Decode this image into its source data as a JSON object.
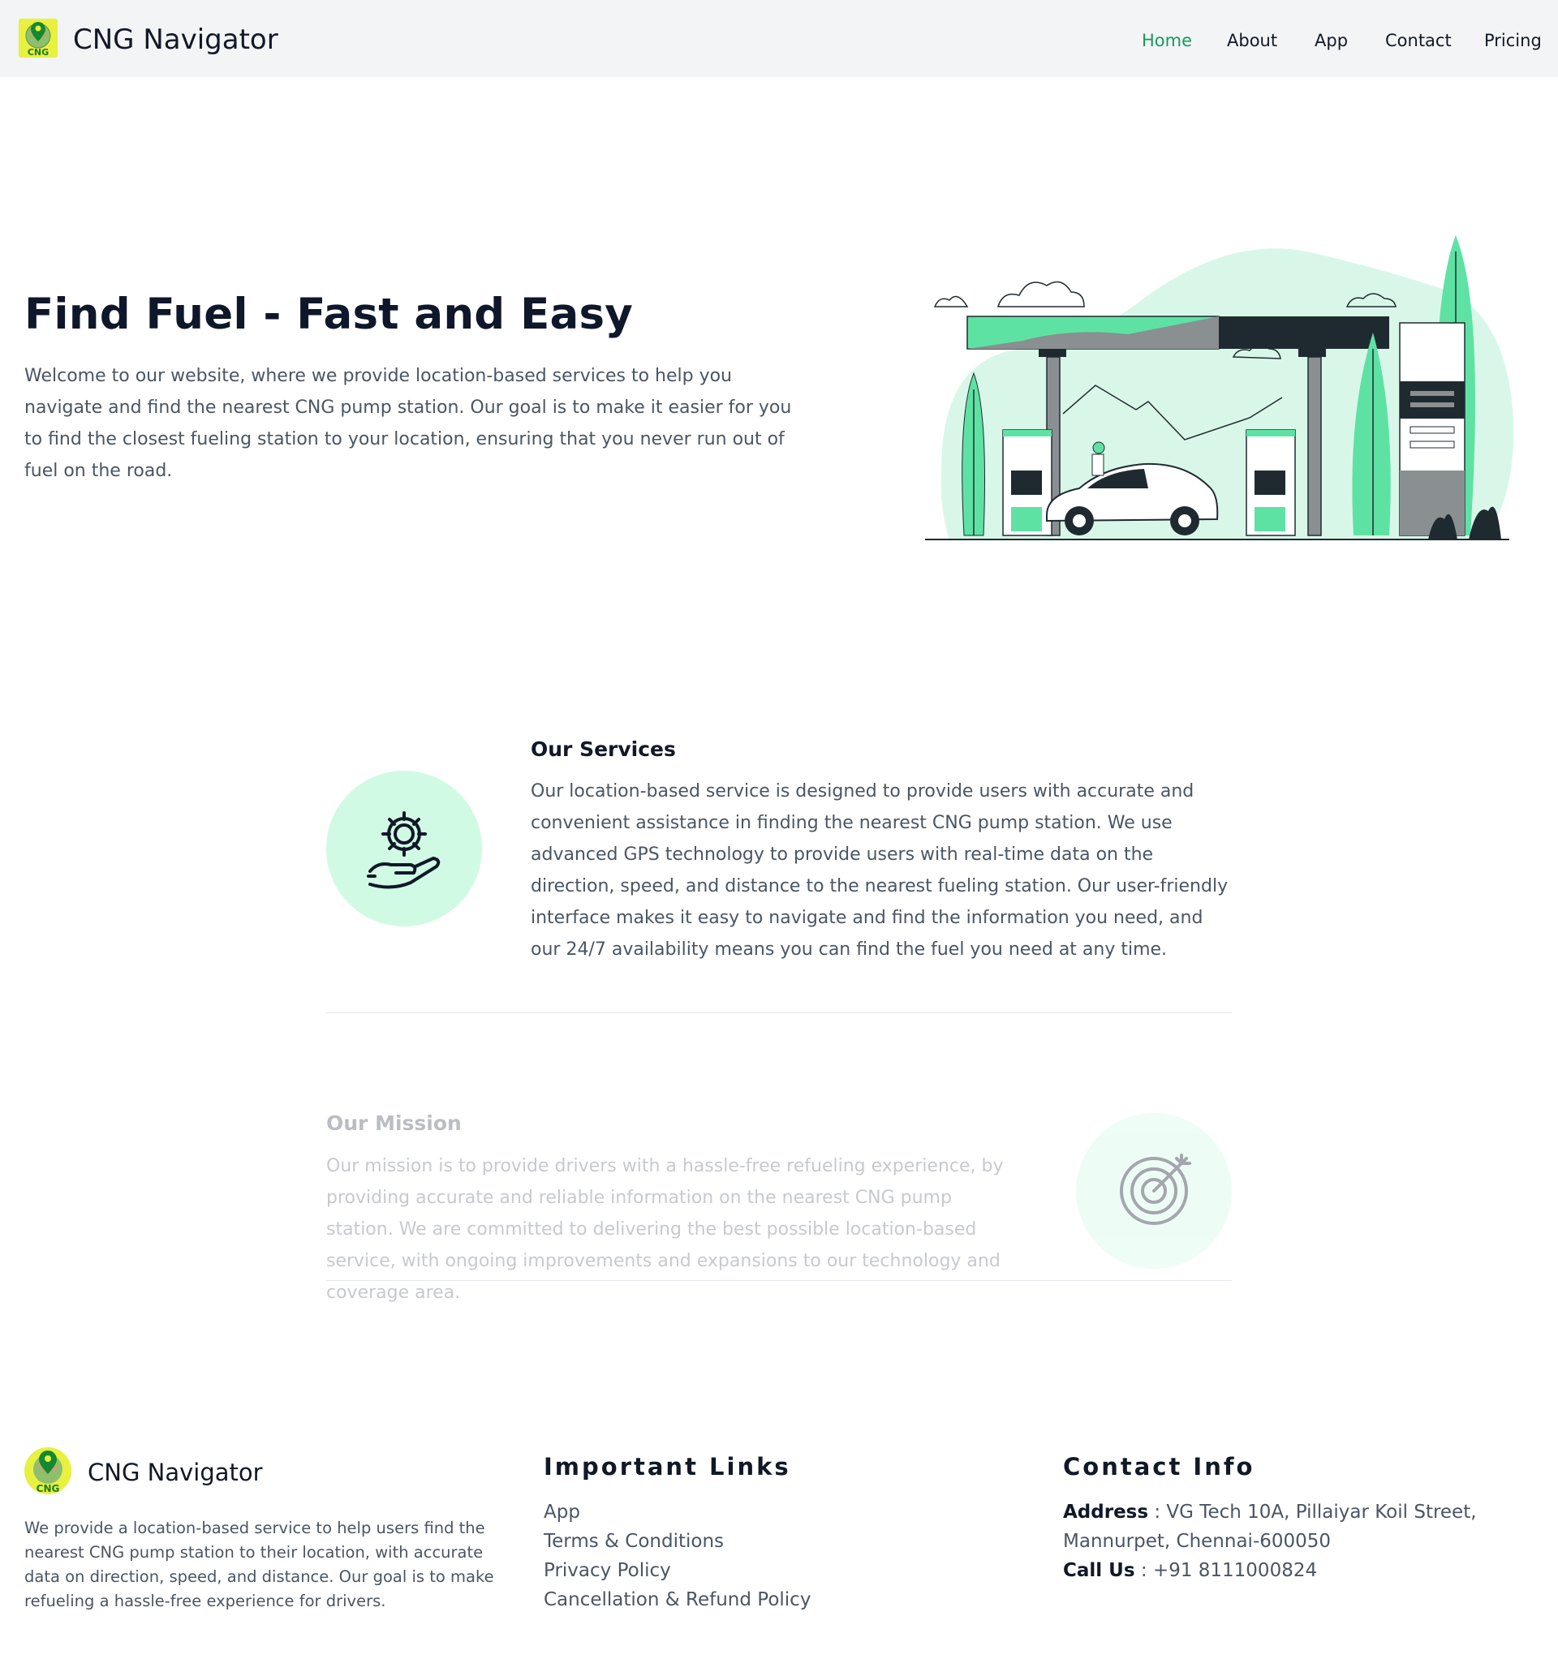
{
  "colors": {
    "nav_bg": "#f3f4f6",
    "active_link": "#149a5e",
    "accent_green": "#5ee2a4",
    "light_green": "#d1fae5",
    "dark": "#1f2a30"
  },
  "header": {
    "logo_icon": "cng-map-pin-logo",
    "logo_text": "CNG",
    "brand": "CNG Navigator",
    "nav": [
      {
        "label": "Home",
        "active": true
      },
      {
        "label": "About",
        "active": false
      },
      {
        "label": "App",
        "active": false
      },
      {
        "label": "Contact",
        "active": false
      },
      {
        "label": "Pricing",
        "active": false
      }
    ]
  },
  "hero": {
    "title": "Find Fuel - Fast and Easy",
    "text": "Welcome to our website, where we provide location-based services to help you navigate and find the nearest CNG pump station. Our goal is to make it easier for you to find the closest fueling station to your location, ensuring that you never run out of fuel on the road.",
    "illustration": "gas-station-illustration"
  },
  "services": {
    "icon": "gear-in-hand-icon",
    "title": "Our Services",
    "text": "Our location-based service is designed to provide users with accurate and convenient assistance in finding the nearest CNG pump station. We use advanced GPS technology to provide users with real-time data on the direction, speed, and distance to the nearest fueling station. Our user-friendly interface makes it easy to navigate and find the information you need, and our 24/7 availability means you can find the fuel you need at any time."
  },
  "mission": {
    "icon": "target-arrow-icon",
    "title": "Our Mission",
    "text": "Our mission is to provide drivers with a hassle-free refueling experience, by providing accurate and reliable information on the nearest CNG pump station. We are committed to delivering the best possible location-based service, with ongoing improvements and expansions to our technology and coverage area."
  },
  "footer": {
    "brand": "CNG Navigator",
    "logo_text": "CNG",
    "description": "We provide a location-based service to help users find the nearest CNG pump station to their location, with accurate data on direction, speed, and distance. Our goal is to make refueling a hassle-free experience for drivers.",
    "links_title": "Important Links",
    "links": [
      "App",
      "Terms & Conditions",
      "Privacy Policy",
      "Cancellation & Refund Policy"
    ],
    "contact_title": "Contact Info",
    "address_label": "Address",
    "address": " : VG Tech 10A, Pillaiyar Koil Street, Mannurpet, Chennai-600050",
    "call_label": "Call Us",
    "phone": " : +91 8111000824"
  }
}
